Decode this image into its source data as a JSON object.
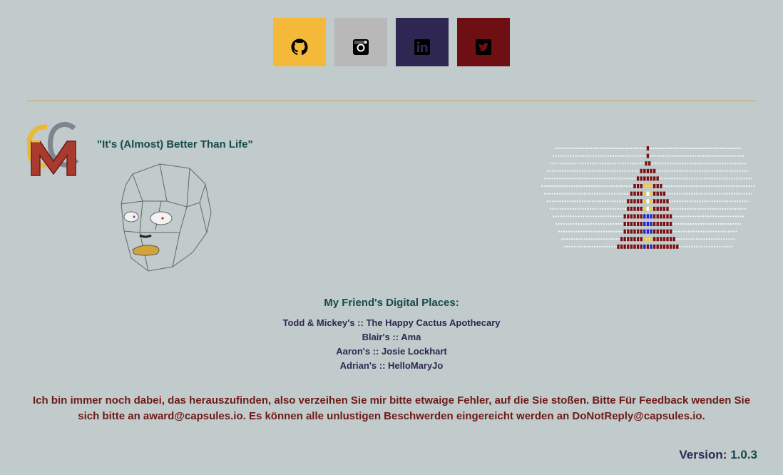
{
  "social": {
    "github": "github-icon",
    "instagram": "instagram-icon",
    "linkedin": "linkedin-icon",
    "twitter": "twitter-icon"
  },
  "colors": {
    "background": "#c1cbcb",
    "github": "#f5b93a",
    "instagram": "#b8b8b8",
    "linkedin": "#2e2752",
    "twitter": "#6e0f14",
    "divider": "#c9a24a",
    "teal": "#164a4a",
    "maroon": "#6e1a18"
  },
  "tagline": "\"It's (Almost) Better Than Life\"",
  "friends": {
    "title": "My Friend's Digital Places:",
    "items": [
      {
        "owner": "Todd & Mickey's",
        "sep": " :: ",
        "site": "The Happy Cactus Apothecary"
      },
      {
        "owner": "Blair's",
        "sep": " :: ",
        "site": "Ama"
      },
      {
        "owner": "Aaron's",
        "sep": " :: ",
        "site": "Josie Lockhart"
      },
      {
        "owner": "Adrian's",
        "sep": " :: ",
        "site": "HelloMaryJo"
      }
    ]
  },
  "notice": "Ich bin immer noch dabei, das herauszufinden, also verzeihen Sie mir bitte etwaige Fehler, auf die Sie stoßen. Bitte Für Feedback wenden Sie sich bitte an award@capsules.io. Es können alle unlustigen Beschwerden eingereicht werden an DoNotReply@capsules.io.",
  "version": {
    "label": "Version:",
    "number": "1.0.3"
  }
}
